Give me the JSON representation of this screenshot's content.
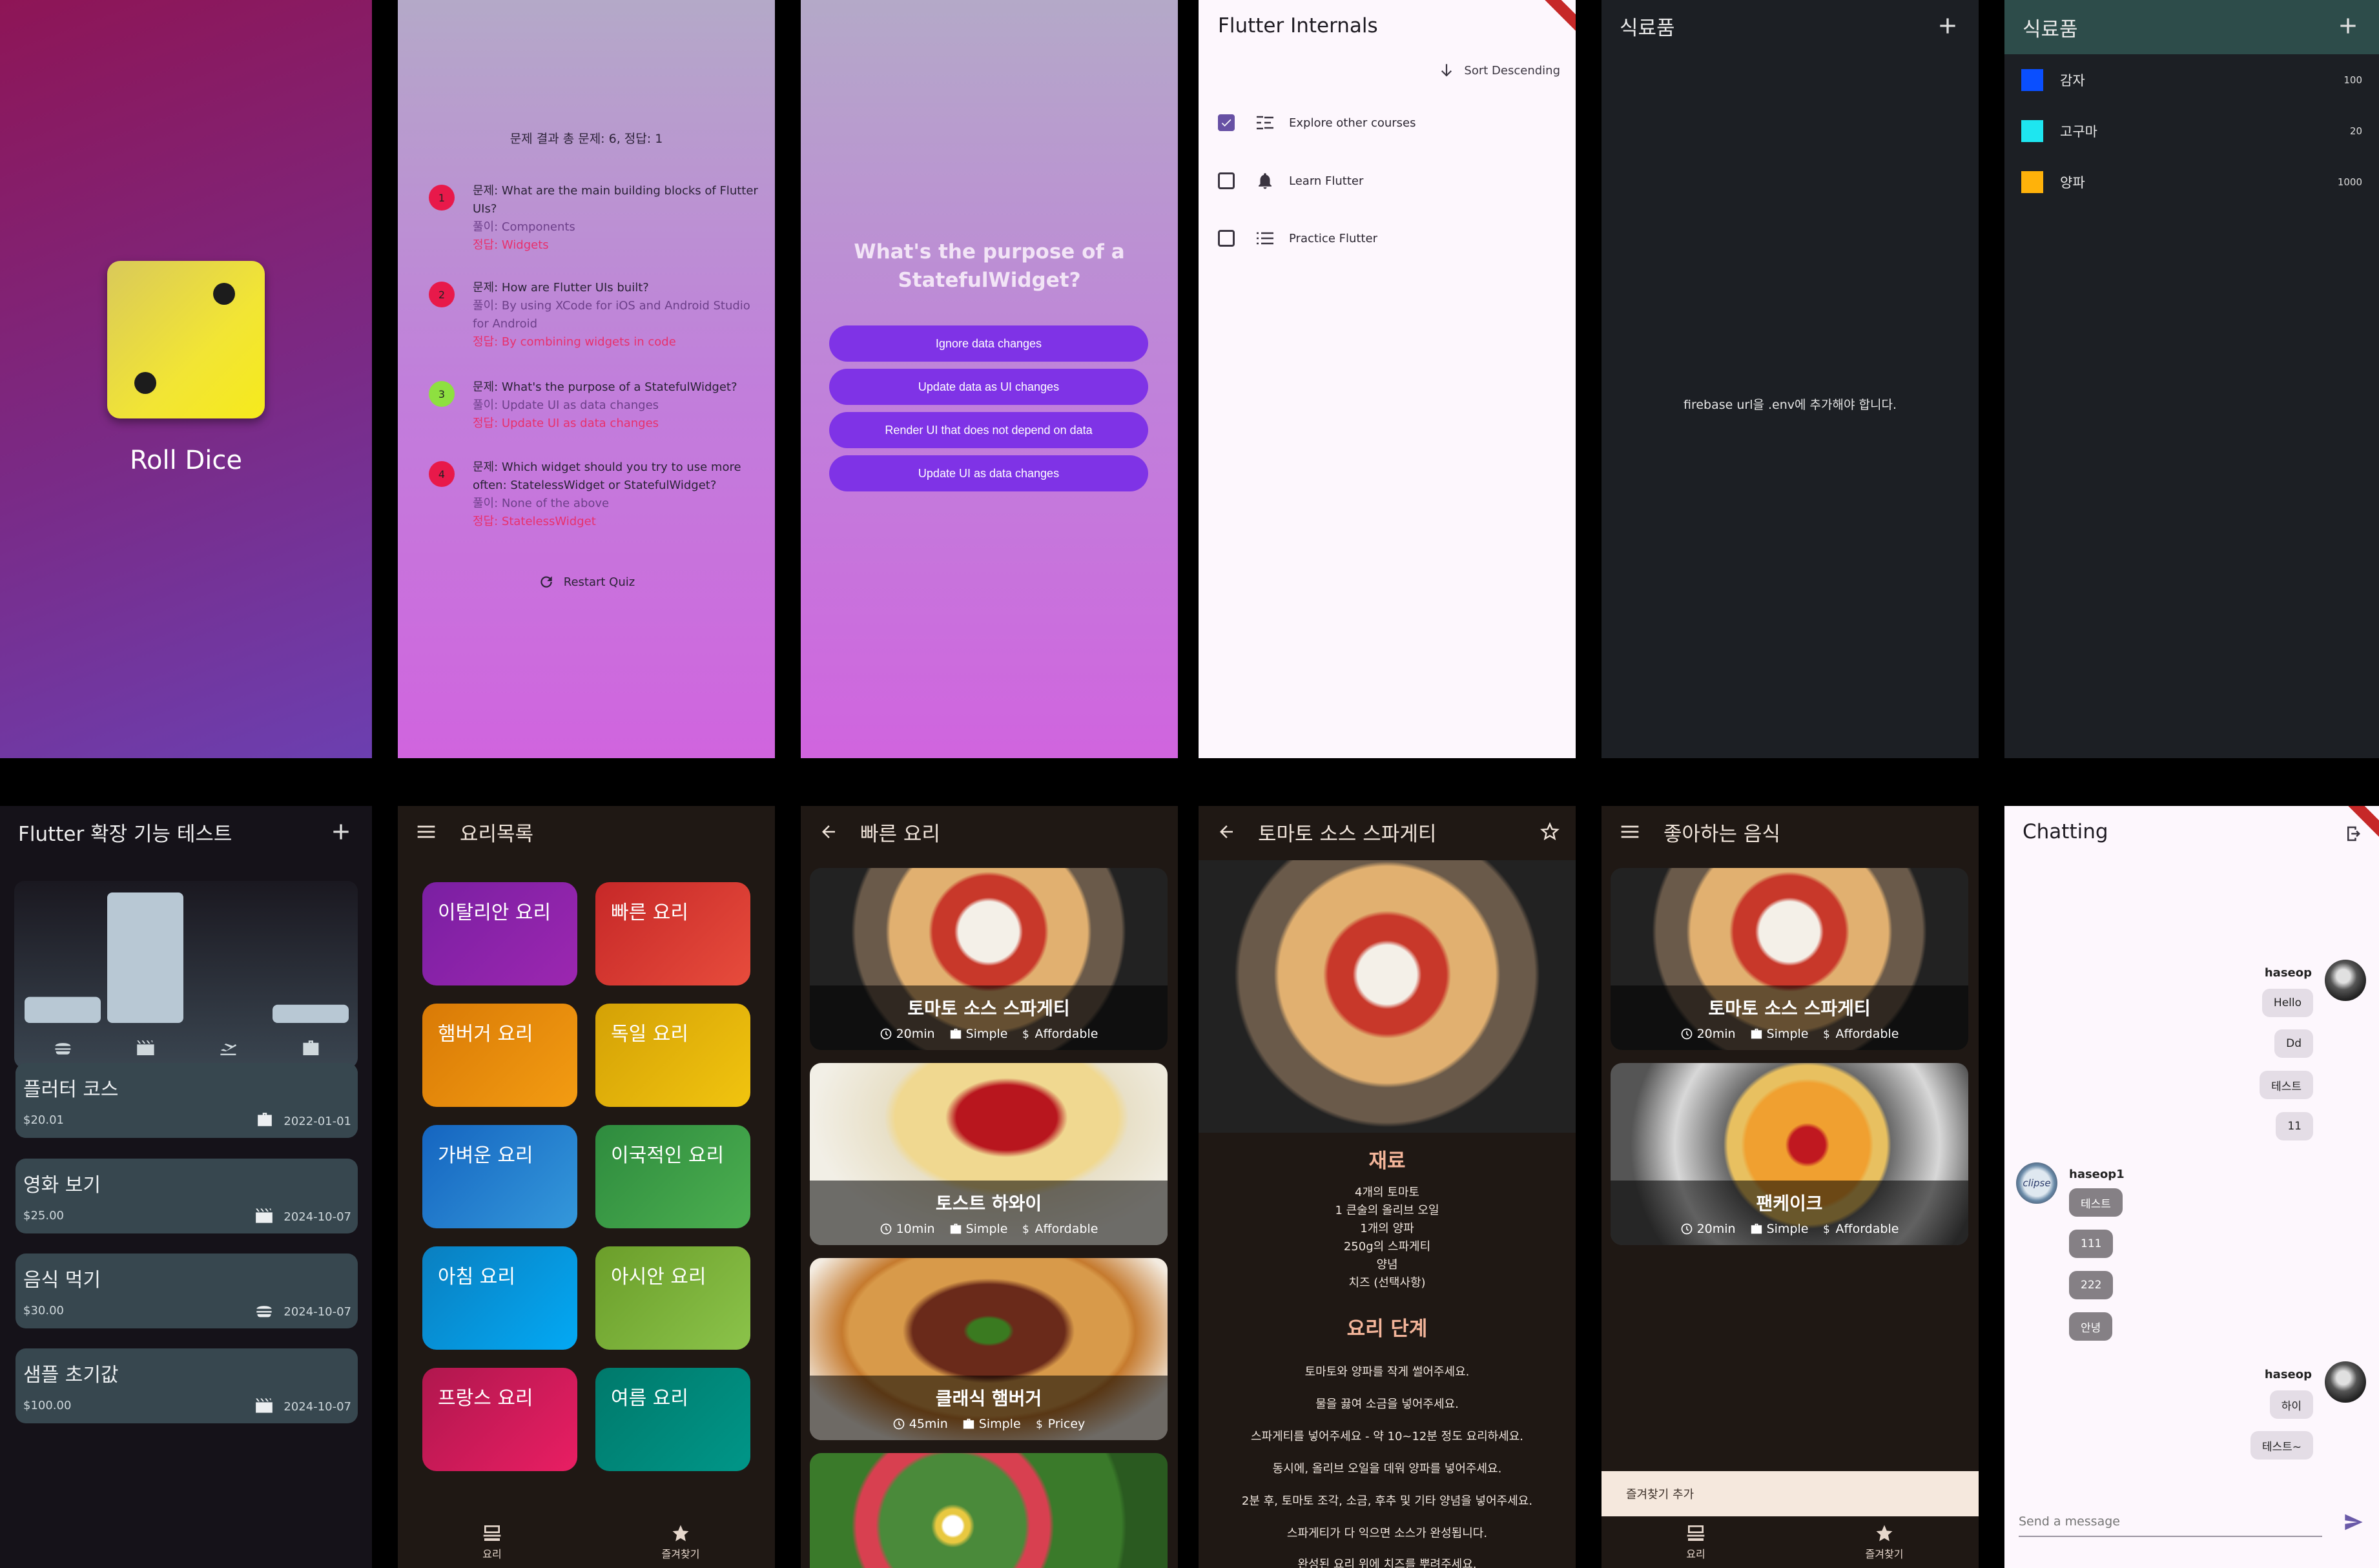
{
  "dice": {
    "label": "Roll Dice"
  },
  "quiz_summary": {
    "title": "문제 결과 총 문제: 6, 정답: 1",
    "items": [
      {
        "num": "1",
        "correct": false,
        "question": "문제: What are the main building blocks of Flutter UIs?",
        "user": "풀이: Components",
        "answer": "정답: Widgets"
      },
      {
        "num": "2",
        "correct": false,
        "question": "문제: How are Flutter UIs built?",
        "user": "풀이: By using XCode for iOS and Android Studio for Android",
        "answer": "정답: By combining widgets in code"
      },
      {
        "num": "3",
        "correct": true,
        "question": "문제: What's the purpose of a StatefulWidget?",
        "user": "풀이: Update UI as data changes",
        "answer": "정답: Update UI as data changes"
      },
      {
        "num": "4",
        "correct": false,
        "question": "문제: Which widget should you try to use more often: StatelessWidget or StatefulWidget?",
        "user": "풀이: None of the above",
        "answer": "정답: StatelessWidget"
      }
    ],
    "restart": "Restart Quiz",
    "colors": {
      "wrong": "#e8194a",
      "right": "#8ee040"
    }
  },
  "question": {
    "text": "What's the purpose of a StatefulWidget?",
    "answers": [
      "Ignore data changes",
      "Update data as UI changes",
      "Render UI that does not depend on data",
      "Update UI as data changes"
    ]
  },
  "internals": {
    "title": "Flutter Internals",
    "sort": "Sort Descending",
    "todos": [
      {
        "label": "Explore other courses",
        "checked": true,
        "icon": "list-icon"
      },
      {
        "label": "Learn Flutter",
        "checked": false,
        "icon": "bell-icon"
      },
      {
        "label": "Practice Flutter",
        "checked": false,
        "icon": "list-icon"
      }
    ]
  },
  "grocery_empty": {
    "title": "식료품",
    "message": "firebase url을 .env에 추가해야 합니다."
  },
  "grocery_list": {
    "title": "식료품",
    "items": [
      {
        "name": "감자",
        "qty": "100",
        "color": "#0a4fff"
      },
      {
        "name": "고구마",
        "qty": "20",
        "color": "#1ee6f0"
      },
      {
        "name": "양파",
        "qty": "1000",
        "color": "#ffb20a"
      }
    ]
  },
  "expenses": {
    "title": "Flutter 확장 기능 테스트",
    "chart_data": {
      "type": "bar",
      "categories": [
        "food",
        "leisure",
        "travel",
        "work"
      ],
      "values": [
        0.2,
        1.0,
        0,
        0.14
      ]
    },
    "items": [
      {
        "title": "플러터 코스",
        "amount": "$20.01",
        "date": "2022-01-01",
        "icon": "work-icon"
      },
      {
        "title": "영화 보기",
        "amount": "$25.00",
        "date": "2024-10-07",
        "icon": "leisure-icon"
      },
      {
        "title": "음식 먹기",
        "amount": "$30.00",
        "date": "2024-10-07",
        "icon": "food-icon"
      },
      {
        "title": "샘플 초기값",
        "amount": "$100.00",
        "date": "2024-10-07",
        "icon": "leisure-icon"
      }
    ]
  },
  "categories": {
    "title": "요리목록",
    "items": [
      {
        "label": "이탈리안 요리",
        "c1": "#7a1fa2",
        "c2": "#9c27b0"
      },
      {
        "label": "빠른 요리",
        "c1": "#c62828",
        "c2": "#e74c3c"
      },
      {
        "label": "햄버거 요리",
        "c1": "#d97a06",
        "c2": "#f39c12"
      },
      {
        "label": "독일 요리",
        "c1": "#d4a106",
        "c2": "#f1c40f"
      },
      {
        "label": "가벼운 요리",
        "c1": "#1565c0",
        "c2": "#3498db"
      },
      {
        "label": "이국적인 요리",
        "c1": "#2e8b3e",
        "c2": "#4caf50"
      },
      {
        "label": "아침 요리",
        "c1": "#0a7fc0",
        "c2": "#03a9f4"
      },
      {
        "label": "아시안 요리",
        "c1": "#6b9e2a",
        "c2": "#8bc34a"
      },
      {
        "label": "프랑스 요리",
        "c1": "#b0174e",
        "c2": "#e91e63"
      },
      {
        "label": "여름 요리",
        "c1": "#00796b",
        "c2": "#009688"
      }
    ],
    "nav": [
      "요리",
      "즐겨찾기"
    ]
  },
  "quick_meals": {
    "title": "빠른 요리",
    "meals": [
      {
        "title": "토마토 소스 스파게티",
        "time": "20min",
        "complexity": "Simple",
        "price": "Affordable"
      },
      {
        "title": "토스트 하와이",
        "time": "10min",
        "complexity": "Simple",
        "price": "Affordable"
      },
      {
        "title": "클래식 햄버거",
        "time": "45min",
        "complexity": "Simple",
        "price": "Pricey"
      }
    ]
  },
  "detail": {
    "title": "토마토 소스 스파게티",
    "ingredients_title": "재료",
    "ingredients": [
      "4개의 토마토",
      "1 큰술의 올리브 오일",
      "1개의 양파",
      "250g의 스파게티",
      "양념",
      "치즈 (선택사항)"
    ],
    "steps_title": "요리 단계",
    "steps": [
      "토마토와 양파를 작게 썰어주세요.",
      "물을 끓여 소금을 넣어주세요.",
      "스파게티를 넣어주세요 - 약 10~12분 정도 요리하세요.",
      "동시에, 올리브 오일을 데워 양파를 넣어주세요.",
      "2분 후, 토마토 조각, 소금, 후추 및 기타 양념을 넣어주세요.",
      "스파게티가 다 익으면 소스가 완성됩니다.",
      "완성된 요리 위에 치즈를 뿌려주세요."
    ]
  },
  "favorites": {
    "title": "좋아하는 음식",
    "meals": [
      {
        "title": "토마토 소스 스파게티",
        "time": "20min",
        "complexity": "Simple",
        "price": "Affordable"
      },
      {
        "title": "팬케이크",
        "time": "20min",
        "complexity": "Simple",
        "price": "Affordable"
      }
    ],
    "snack": "즐겨찾기 추가",
    "nav": [
      "요리",
      "즐겨찾기"
    ]
  },
  "chat": {
    "title": "Chatting",
    "user1": "haseop",
    "user2": "haseop1",
    "user3": "haseop",
    "msgs1": [
      "Hello",
      "Dd",
      "테스트",
      "11"
    ],
    "msgs2": [
      "테스트",
      "111",
      "222",
      "안녕"
    ],
    "msgs3": [
      "하이",
      "테스트~"
    ],
    "input_placeholder": "Send a message",
    "avatar2_text": "clipse"
  }
}
